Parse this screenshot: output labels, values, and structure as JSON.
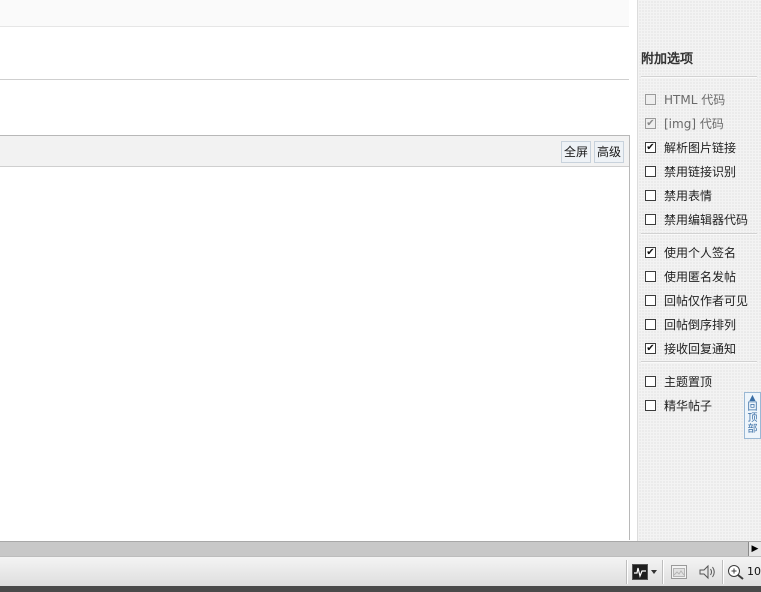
{
  "editor": {
    "fullscreen_label": "全屏",
    "advanced_label": "高级"
  },
  "sidebar": {
    "title": "附加选项",
    "groups": [
      [
        {
          "label": "HTML 代码",
          "checked": false,
          "disabled": true
        },
        {
          "label": "[img] 代码",
          "checked": true,
          "disabled": true
        },
        {
          "label": "解析图片链接",
          "checked": true,
          "disabled": false
        },
        {
          "label": "禁用链接识别",
          "checked": false,
          "disabled": false
        },
        {
          "label": "禁用表情",
          "checked": false,
          "disabled": false
        },
        {
          "label": "禁用编辑器代码",
          "checked": false,
          "disabled": false
        }
      ],
      [
        {
          "label": "使用个人签名",
          "checked": true,
          "disabled": false
        },
        {
          "label": "使用匿名发帖",
          "checked": false,
          "disabled": false
        },
        {
          "label": "回帖仅作者可见",
          "checked": false,
          "disabled": false
        },
        {
          "label": "回帖倒序排列",
          "checked": false,
          "disabled": false
        },
        {
          "label": "接收回复通知",
          "checked": true,
          "disabled": false
        }
      ],
      [
        {
          "label": "主题置顶",
          "checked": false,
          "disabled": false
        },
        {
          "label": "精华帖子",
          "checked": false,
          "disabled": false
        }
      ]
    ]
  },
  "back_to_top": {
    "label": "回顶部",
    "l1": "回",
    "l2": "顶",
    "l3": "部"
  },
  "statusbar": {
    "zoom": "10"
  },
  "icons": {
    "check": "✔",
    "scroll_right": "▶",
    "back_top_arrow": "▲"
  }
}
